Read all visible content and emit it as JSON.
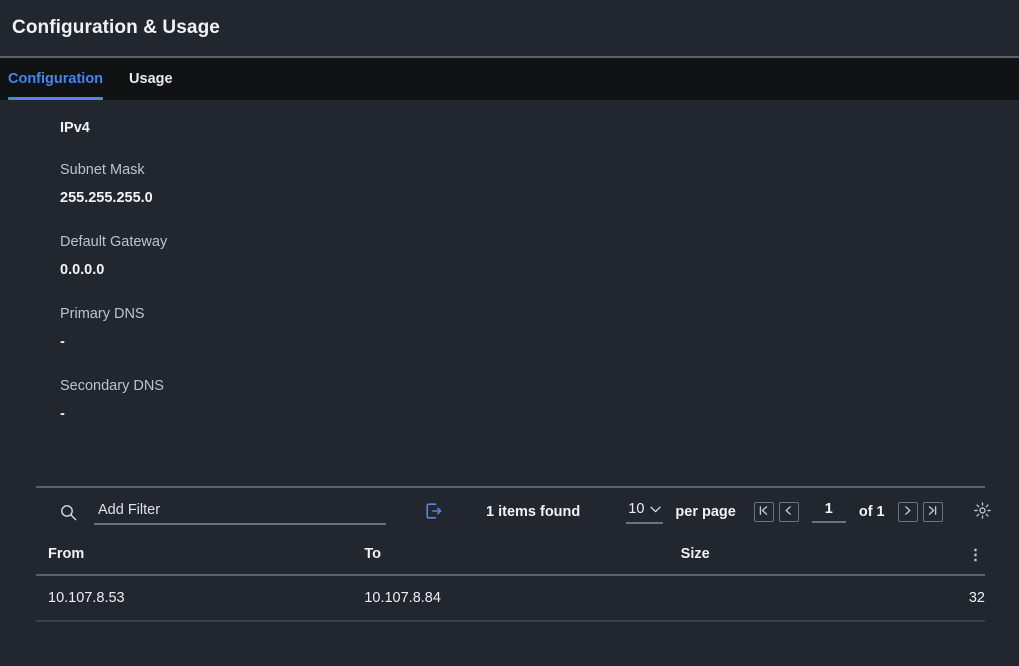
{
  "header": {
    "title": "Configuration & Usage"
  },
  "tabs": [
    {
      "label": "Configuration",
      "active": true
    },
    {
      "label": "Usage",
      "active": false
    }
  ],
  "configuration": {
    "section_title": "IPv4",
    "fields": [
      {
        "label": "Subnet Mask",
        "value": "255.255.255.0"
      },
      {
        "label": "Default Gateway",
        "value": "0.0.0.0"
      },
      {
        "label": "Primary DNS",
        "value": "-"
      },
      {
        "label": "Secondary DNS",
        "value": "-"
      }
    ]
  },
  "toolbar": {
    "search_icon": "search-icon",
    "filter_placeholder": "Add Filter",
    "filter_value": "",
    "export_icon": "export-icon",
    "items_found": "1 items found",
    "per_page_value": "10",
    "per_page_label": "per page",
    "page_value": "1",
    "page_total": "of 1",
    "first_page_icon": "first-page-icon",
    "prev_page_icon": "previous-page-icon",
    "next_page_icon": "next-page-icon",
    "last_page_icon": "last-page-icon",
    "settings_icon": "gear-icon"
  },
  "table": {
    "columns": [
      "From",
      "To",
      "Size"
    ],
    "size_menu_icon": "more-options-icon",
    "rows": [
      {
        "from": "10.107.8.53",
        "to": "10.107.8.84",
        "size": "32"
      }
    ]
  },
  "colors": {
    "accent": "#4285f4",
    "background": "#22262e",
    "tab_bar_background": "#111214",
    "divider": "#5a616e",
    "text_primary": "#f0f2f5",
    "text_secondary": "#bdc3cc"
  }
}
